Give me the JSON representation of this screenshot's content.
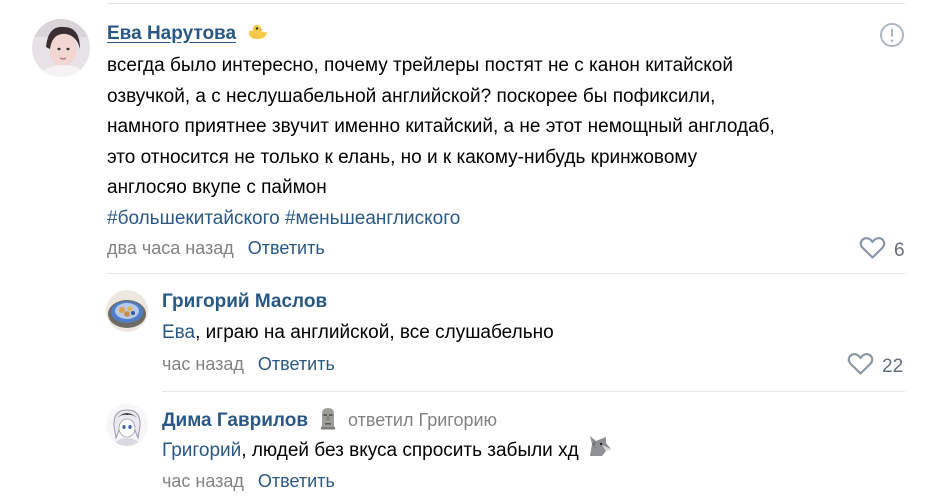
{
  "comments": [
    {
      "author": "Ева Нарутова",
      "badge_icon": "duck-icon",
      "text_lines": [
        "всегда было интересно, почему трейлеры постят не с канон китайской",
        "озвучкой, а с неслушабельной английской? поскорее бы пофиксили,",
        "намного приятнее звучит именно китайский, а не этот немощный англодаб,",
        "это относится не только к елань, но и к какому-нибудь кринжовому",
        "англосяо вкупе с паймон"
      ],
      "hashtags": [
        "#большекитайского",
        "#меньшеанглиского"
      ],
      "time": "два часа назад",
      "reply_label": "Ответить",
      "likes": "6"
    },
    {
      "author": "Григорий Маслов",
      "mention": "Ева",
      "text": ", играю на английской, все слушабельно",
      "time": "час назад",
      "reply_label": "Ответить",
      "likes": "22"
    },
    {
      "author": "Дима Гаврилов",
      "badge_icon": "moai-icon",
      "replied_to": "ответил Григорию",
      "mention": "Григорий",
      "text": ", людей без вкуса спросить забыли хд",
      "emoji": "wolf-emoji",
      "time": "час назад",
      "reply_label": "Ответить"
    }
  ],
  "colors": {
    "link": "#2a5885",
    "muted": "#828282",
    "divider": "#e7e8ec",
    "like_icon": "#8a97a7"
  }
}
